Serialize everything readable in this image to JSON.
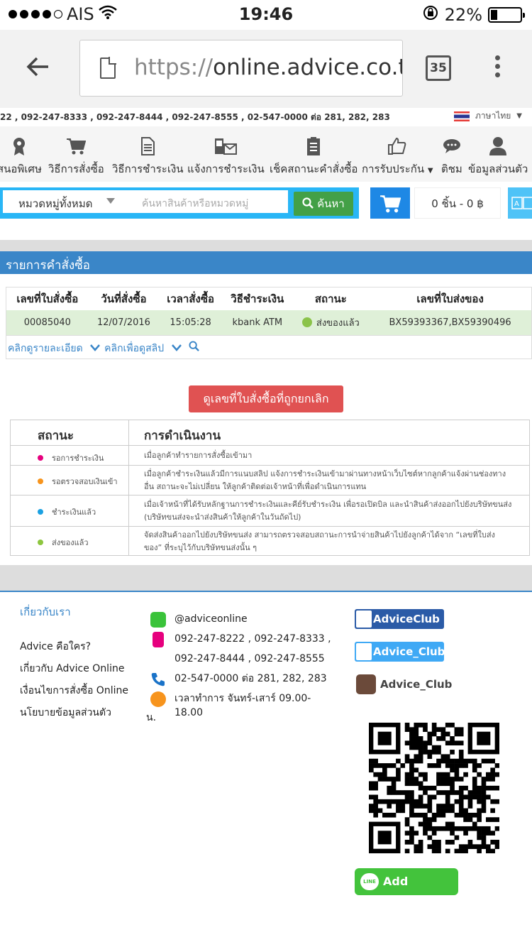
{
  "status_bar": {
    "carrier": "AIS",
    "time": "19:46",
    "battery": "22%"
  },
  "browser": {
    "url_scheme": "https://",
    "url_host": "online.advice.co.th",
    "tab_count": "35"
  },
  "contact_strip": {
    "phones": "22 , 092-247-8333 , 092-247-8444 , 092-247-8555 , 02-547-0000 ต่อ 281, 282, 283",
    "language": "ภาษาไทย"
  },
  "nav": [
    {
      "label": "สนอพิเศษ",
      "icon": "award-icon"
    },
    {
      "label": "วิธีการสั่งซื้อ",
      "icon": "cart-icon"
    },
    {
      "label": "วิธีการชำระเงิน",
      "icon": "document-icon"
    },
    {
      "label": "แจ้งการชำระเงิน",
      "icon": "payment-notice-icon"
    },
    {
      "label": "เช็คสถานะคำสั่งซื้อ",
      "icon": "clipboard-icon"
    },
    {
      "label": "การรับประกัน",
      "icon": "thumbs-up-icon"
    },
    {
      "label": "ติชม",
      "icon": "chat-icon"
    },
    {
      "label": "ข้อมูลส่วนตัว",
      "icon": "user-icon"
    }
  ],
  "search": {
    "category": "หมวดหมู่ทั้งหมด",
    "placeholder": "ค้นหาสินค้าหรือหมวดหมู่",
    "button": "ค้นหา"
  },
  "cart": {
    "summary": "0 ชิ้น - 0 ฿"
  },
  "orders": {
    "title": "รายการคำสั่งซื้อ",
    "headers": [
      "เลขที่ใบสั่งซื้อ",
      "วันที่สั่งซื้อ",
      "เวลาสั่งซื้อ",
      "วิธีชำระเงิน",
      "สถานะ",
      "เลขที่ใบส่งของ"
    ],
    "rows": [
      {
        "order_no": "00085040",
        "date": "12/07/2016",
        "time": "15:05:28",
        "payment": "kbank ATM",
        "status": "ส่งของแล้ว",
        "delivery_no": "BX59393367,BX59390496"
      }
    ],
    "link_details": "คลิกดูรายละเอียด",
    "link_slip": "คลิกเพื่อดูสลิป",
    "cancelled_button": "ดูเลขที่ใบสั่งซื้อที่ถูกยกเลิก"
  },
  "legend": {
    "col_status": "สถานะ",
    "col_action": "การดำเนินงาน",
    "rows": [
      {
        "status": "รอการชำระเงิน",
        "color": "#e6007e",
        "desc": "เมื่อลูกค้าทำรายการสั่งซื้อเข้ามา"
      },
      {
        "status": "รอตรวจสอบเงินเข้า",
        "color": "#f7941d",
        "desc": "เมื่อลูกค้าชำระเงินแล้วมีการแนบสลิป แจ้งการชำระเงินเข้ามาผ่านทางหน้าเว็บไซต์หากลูกค้าแจ้งผ่านช่องทางอื่น สถานะจะไม่เปลี่ยน ให้ลูกค้าติดต่อเจ้าหน้าที่เพื่อดำเนินการแทน"
      },
      {
        "status": "ชำระเงินแล้ว",
        "color": "#1ba1e2",
        "desc": "เมื่อเจ้าหน้าที่ได้รับหลักฐานการชำระเงินและคีย์รับชำระเงิน เพื่อรอเปิดบิล และนำสินค้าส่งออกไปยังบริษัทขนส่ง (บริษัทขนส่งจะนำส่งสินค้าให้ลูกค้าในวันถัดไป)"
      },
      {
        "status": "ส่งของแล้ว",
        "color": "#8dc63f",
        "desc": "จัดส่งสินค้าออกไปยังบริษัทขนส่ง สามารถตรวจสอบสถานะการนำจ่ายสินค้าไปยังลูกค้าได้จาก “เลขที่ใบส่งของ” ที่ระบุไว้กับบริษัทขนส่งนั้น ๆ"
      }
    ]
  },
  "footer": {
    "about_title": "เกี่ยวกับเรา",
    "about_links": [
      "Advice คือใคร?",
      "เกี่ยวกับ Advice Online",
      "เงื่อนไขการสั่งซื้อ Online",
      "นโยบายข้อมูลส่วนตัว"
    ],
    "line_id": "@adviceonline",
    "mobile_1": "092-247-8222 , 092-247-8333 ,",
    "mobile_2": "092-247-8444 , 092-247-8555",
    "phone": "02-547-0000 ต่อ 281, 282, 283",
    "hours": "เวลาทำการ จันทร์-เสาร์ 09.00-18.00",
    "hours_cont": "น.",
    "facebook": "AdviceClub",
    "twitter": "Advice_Club",
    "instagram": "Advice_Club",
    "add_friends": "Add Friends",
    "line_badge": "LINE"
  }
}
